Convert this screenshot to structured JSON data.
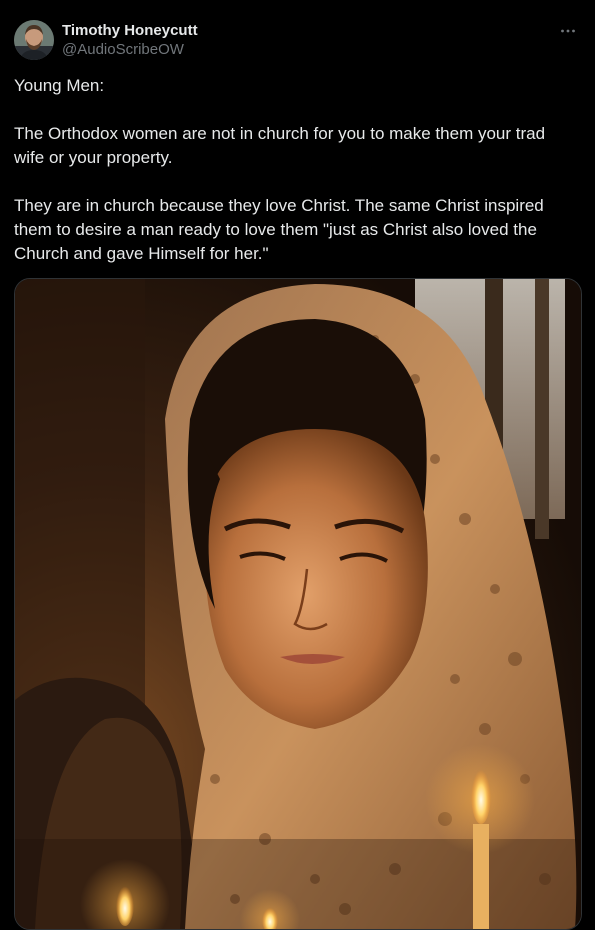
{
  "tweet": {
    "author": {
      "display_name": "Timothy Honeycutt",
      "handle": "@AudioScribeOW",
      "avatar_icon": "avatar-photo"
    },
    "more_icon": "more-horizontal-icon",
    "paragraphs": [
      "Young Men:",
      "The Orthodox women are not in church for you to make them your trad wife or your property.",
      "They are in church because they love Christ. The same Christ inspired them to desire a man ready to love them \"just as Christ also loved the Church and gave Himself for her.\""
    ],
    "media": {
      "kind": "photo"
    }
  },
  "colors": {
    "background": "#000000",
    "text_primary": "#e7e9ea",
    "text_secondary": "#71767b",
    "border": "#2f3336"
  }
}
